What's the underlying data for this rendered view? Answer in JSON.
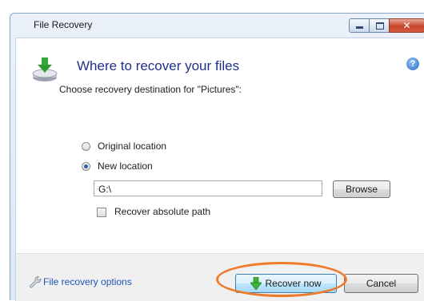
{
  "window": {
    "title": "File Recovery",
    "controls": {
      "minimize_icon": "minimize-icon",
      "maximize_icon": "maximize-icon",
      "close_icon": "close-icon",
      "close_glyph": "✕"
    }
  },
  "header": {
    "icon": "drive-download-icon",
    "title": "Where to recover your files",
    "help_icon": "help-icon",
    "help_glyph": "?"
  },
  "body": {
    "prompt": "Choose recovery destination for \"Pictures\":",
    "options": [
      {
        "label": "Original location",
        "selected": false
      },
      {
        "label": "New location",
        "selected": true
      }
    ],
    "path_value": "G:\\",
    "browse_label": "Browse",
    "absolute_path_label": "Recover absolute path",
    "absolute_path_checked": false
  },
  "footer": {
    "options_icon": "wrench-icon",
    "options_link": "File recovery options",
    "recover_label": "Recover now",
    "recover_icon": "green-down-arrow-icon",
    "cancel_label": "Cancel"
  },
  "colors": {
    "heading": "#1e3287",
    "link": "#1b56b3",
    "highlight_ring": "#ef7a2a"
  }
}
